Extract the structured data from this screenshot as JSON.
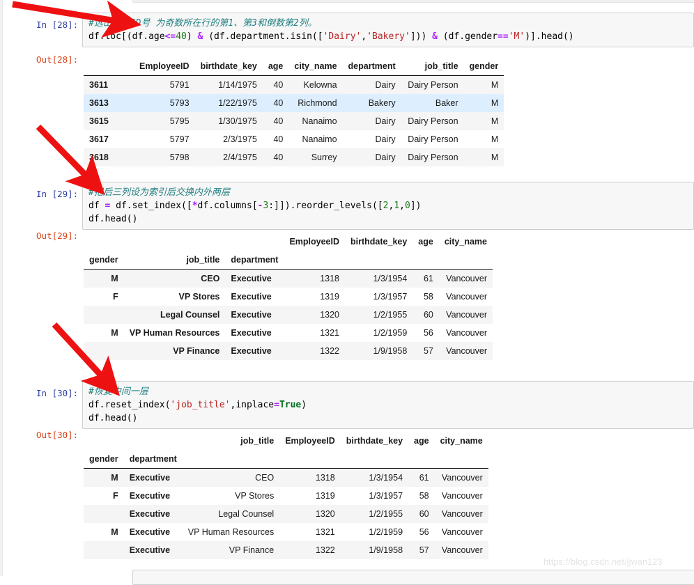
{
  "notebook": {
    "watermark": "https://blog.csdn.net/jjwan123"
  },
  "cells": [
    {
      "in_prompt": "In [28]:",
      "out_prompt": "Out[28]:",
      "code": {
        "line1_comment": "#选出员工ID号 为奇数所在行的第1、第3和倒数第2列。",
        "line2": {
          "p1": "df.loc[(df.age",
          "op1": "<=",
          "n1": "40",
          "p2": ") ",
          "amp1": "&",
          "p3": " (df.department.isin([",
          "s1": "'Dairy'",
          "p4": ",",
          "s2": "'Bakery'",
          "p5": "])) ",
          "amp2": "&",
          "p6": " (df.gender",
          "op2": "==",
          "s3": "'M'",
          "p7": ")].head()"
        }
      },
      "table": {
        "columns": [
          "EmployeeID",
          "birthdate_key",
          "age",
          "city_name",
          "department",
          "job_title",
          "gender"
        ],
        "index_values": [
          "3611",
          "3613",
          "3615",
          "3617",
          "3618"
        ],
        "rows": [
          [
            "5791",
            "1/14/1975",
            "40",
            "Kelowna",
            "Dairy",
            "Dairy Person",
            "M"
          ],
          [
            "5793",
            "1/22/1975",
            "40",
            "Richmond",
            "Bakery",
            "Baker",
            "M"
          ],
          [
            "5795",
            "1/30/1975",
            "40",
            "Nanaimo",
            "Dairy",
            "Dairy Person",
            "M"
          ],
          [
            "5797",
            "2/3/1975",
            "40",
            "Nanaimo",
            "Dairy",
            "Dairy Person",
            "M"
          ],
          [
            "5798",
            "2/4/1975",
            "40",
            "Surrey",
            "Dairy",
            "Dairy Person",
            "M"
          ]
        ],
        "highlighted_row": 1
      }
    },
    {
      "in_prompt": "In [29]:",
      "out_prompt": "Out[29]:",
      "code": {
        "line1_comment": "#把后三列设为索引后交换内外两层",
        "line2": {
          "p1": "df ",
          "op1": "=",
          "p2": " df.set_index([",
          "op2": "*",
          "p3": "df.columns[",
          "op3": "-",
          "n1": "3",
          "p4": ":]]).reorder_levels([",
          "n2": "2",
          "p5": ",",
          "n3": "1",
          "p6": ",",
          "n4": "0",
          "p7": "])"
        },
        "line3": "df.head()"
      },
      "table": {
        "value_columns": [
          "EmployeeID",
          "birthdate_key",
          "age",
          "city_name"
        ],
        "index_names": [
          "gender",
          "job_title",
          "department"
        ],
        "rows": [
          {
            "gender": "M",
            "job_title": "CEO",
            "department": "Executive",
            "values": [
              "1318",
              "1/3/1954",
              "61",
              "Vancouver"
            ]
          },
          {
            "gender": "F",
            "job_title": "VP Stores",
            "department": "Executive",
            "values": [
              "1319",
              "1/3/1957",
              "58",
              "Vancouver"
            ]
          },
          {
            "gender": "",
            "job_title": "Legal Counsel",
            "department": "Executive",
            "values": [
              "1320",
              "1/2/1955",
              "60",
              "Vancouver"
            ]
          },
          {
            "gender": "M",
            "job_title": "VP Human Resources",
            "department": "Executive",
            "values": [
              "1321",
              "1/2/1959",
              "56",
              "Vancouver"
            ]
          },
          {
            "gender": "",
            "job_title": "VP Finance",
            "department": "Executive",
            "values": [
              "1322",
              "1/9/1958",
              "57",
              "Vancouver"
            ]
          }
        ]
      }
    },
    {
      "in_prompt": "In [30]:",
      "out_prompt": "Out[30]:",
      "code": {
        "line1_comment": "#恢复中间一层",
        "line2": {
          "p1": "df.reset_index(",
          "s1": "'job_title'",
          "p2": ",inplace",
          "op1": "=",
          "kw1": "True",
          "p3": ")"
        },
        "line3": "df.head()"
      },
      "table": {
        "value_columns": [
          "job_title",
          "EmployeeID",
          "birthdate_key",
          "age",
          "city_name"
        ],
        "index_names": [
          "gender",
          "department"
        ],
        "rows": [
          {
            "gender": "M",
            "department": "Executive",
            "values": [
              "CEO",
              "1318",
              "1/3/1954",
              "61",
              "Vancouver"
            ]
          },
          {
            "gender": "F",
            "department": "Executive",
            "values": [
              "VP Stores",
              "1319",
              "1/3/1957",
              "58",
              "Vancouver"
            ]
          },
          {
            "gender": "",
            "department": "Executive",
            "values": [
              "Legal Counsel",
              "1320",
              "1/2/1955",
              "60",
              "Vancouver"
            ]
          },
          {
            "gender": "M",
            "department": "Executive",
            "values": [
              "VP Human Resources",
              "1321",
              "1/2/1959",
              "56",
              "Vancouver"
            ]
          },
          {
            "gender": "",
            "department": "Executive",
            "values": [
              "VP Finance",
              "1322",
              "1/9/1958",
              "57",
              "Vancouver"
            ]
          }
        ]
      }
    }
  ],
  "annotations": {
    "arrow_color": "#ee1111",
    "arrows": [
      {
        "name": "arrow-to-cell-28"
      },
      {
        "name": "arrow-to-cell-29"
      },
      {
        "name": "arrow-to-cell-30"
      }
    ]
  }
}
